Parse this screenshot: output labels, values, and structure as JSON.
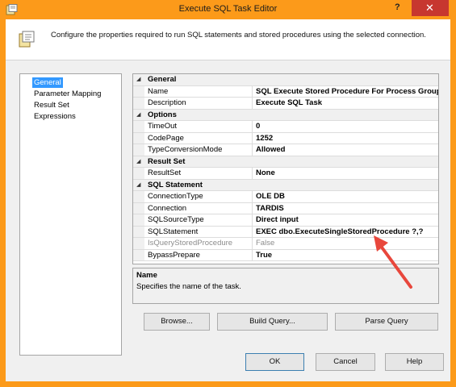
{
  "window": {
    "title": "Execute SQL Task Editor",
    "help_glyph": "?",
    "close_glyph": "✕",
    "accent_color": "#fc9a1a"
  },
  "header": {
    "text": "Configure the properties required to run SQL statements and stored procedures using the selected connection."
  },
  "nav": {
    "items": [
      {
        "label": "General",
        "selected": true
      },
      {
        "label": "Parameter Mapping",
        "selected": false
      },
      {
        "label": "Result Set",
        "selected": false
      },
      {
        "label": "Expressions",
        "selected": false
      }
    ]
  },
  "grid": {
    "sections": [
      {
        "category": "General",
        "properties": [
          {
            "name": "Name",
            "value": "SQL Execute Stored Procedure For Process Group"
          },
          {
            "name": "Description",
            "value": "Execute SQL Task"
          }
        ]
      },
      {
        "category": "Options",
        "properties": [
          {
            "name": "TimeOut",
            "value": "0"
          },
          {
            "name": "CodePage",
            "value": "1252"
          },
          {
            "name": "TypeConversionMode",
            "value": "Allowed"
          }
        ]
      },
      {
        "category": "Result Set",
        "properties": [
          {
            "name": "ResultSet",
            "value": "None"
          }
        ]
      },
      {
        "category": "SQL Statement",
        "properties": [
          {
            "name": "ConnectionType",
            "value": "OLE DB"
          },
          {
            "name": "Connection",
            "value": "TARDIS"
          },
          {
            "name": "SQLSourceType",
            "value": "Direct input"
          },
          {
            "name": "SQLStatement",
            "value": "EXEC dbo.ExecuteSingleStoredProcedure ?,?"
          },
          {
            "name": "IsQueryStoredProcedure",
            "value": "False",
            "disabled": true
          },
          {
            "name": "BypassPrepare",
            "value": "True"
          }
        ]
      }
    ]
  },
  "description": {
    "title": "Name",
    "text": "Specifies the name of the task."
  },
  "buttons": {
    "browse": "Browse...",
    "build_query": "Build Query...",
    "parse_query": "Parse Query",
    "ok": "OK",
    "cancel": "Cancel",
    "help": "Help"
  }
}
